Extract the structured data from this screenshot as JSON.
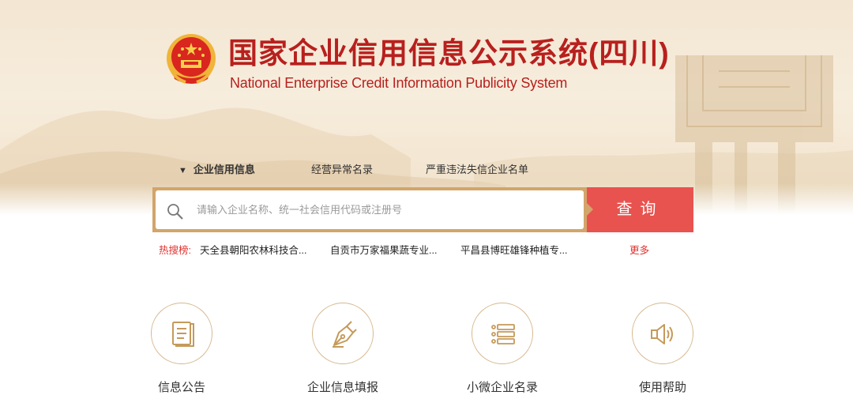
{
  "header": {
    "title_cn": "国家企业信用信息公示系统",
    "title_region": "(四川)",
    "title_en": "National Enterprise Credit Information Publicity System"
  },
  "tabs": [
    {
      "label": "企业信用信息",
      "active": true
    },
    {
      "label": "经营异常名录",
      "active": false
    },
    {
      "label": "严重违法失信企业名单",
      "active": false
    }
  ],
  "search": {
    "placeholder": "请输入企业名称、统一社会信用代码或注册号",
    "button_label": "查询"
  },
  "hot_search": {
    "label": "热搜榜:",
    "items": [
      "天全县朝阳农林科技合...",
      "自贡市万家福果蔬专业...",
      "平昌县博旺雄锋种植专..."
    ],
    "more": "更多"
  },
  "features": [
    {
      "label": "信息公告",
      "icon": "document-icon"
    },
    {
      "label": "企业信息填报",
      "icon": "pen-icon"
    },
    {
      "label": "小微企业名录",
      "icon": "list-icon"
    },
    {
      "label": "使用帮助",
      "icon": "speaker-icon"
    }
  ],
  "colors": {
    "brand_red": "#b8201e",
    "search_button": "#e8534f",
    "search_border": "#d2a56a",
    "hot_red": "#e0302c",
    "circle_border": "#d6b98f"
  }
}
